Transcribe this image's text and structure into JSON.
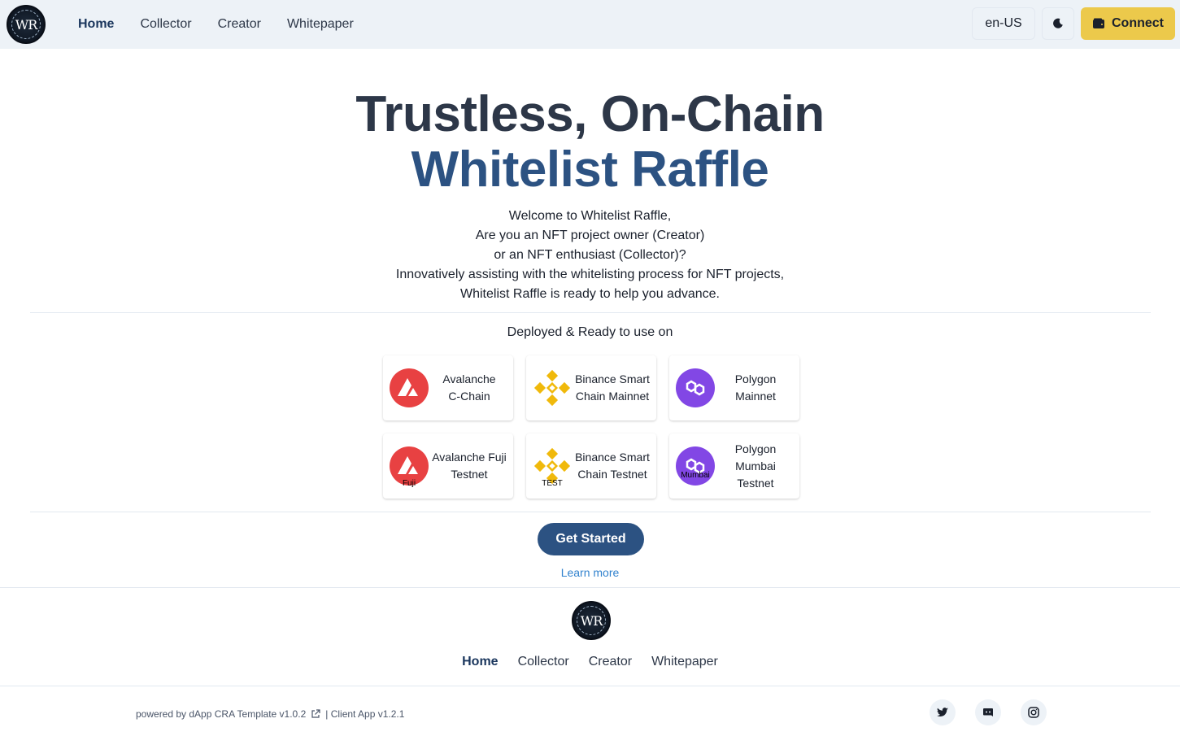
{
  "header": {
    "logo_text": "WR",
    "nav": [
      "Home",
      "Collector",
      "Creator",
      "Whitepaper"
    ],
    "language": "en-US",
    "connect_label": "Connect"
  },
  "hero": {
    "title_line1": "Trustless, On-Chain",
    "title_line2": "Whitelist Raffle",
    "intro": [
      "Welcome to Whitelist Raffle,",
      "Are you an NFT project owner (Creator)",
      "or an NFT enthusiast (Collector)?",
      "Innovatively assisting with the whitelisting process for NFT projects,",
      "Whitelist Raffle is ready to help you advance."
    ]
  },
  "deployed": {
    "heading": "Deployed & Ready to use on",
    "chains": [
      {
        "label_lines": [
          "Avalanche",
          "C-Chain"
        ],
        "icon": "avalanche-icon",
        "badge": ""
      },
      {
        "label_lines": [
          "Binance Smart",
          "Chain Mainnet"
        ],
        "icon": "binance-icon",
        "badge": ""
      },
      {
        "label_lines": [
          "Polygon",
          "Mainnet"
        ],
        "icon": "polygon-icon",
        "badge": ""
      },
      {
        "label_lines": [
          "Avalanche Fuji",
          "Testnet"
        ],
        "icon": "avalanche-icon",
        "badge": "Fuji"
      },
      {
        "label_lines": [
          "Binance Smart",
          "Chain Testnet"
        ],
        "icon": "binance-icon",
        "badge": "TEST"
      },
      {
        "label_lines": [
          "Polygon",
          "Mumbai",
          "Testnet"
        ],
        "icon": "polygon-icon",
        "badge": "Mumbai"
      }
    ]
  },
  "cta": {
    "get_started": "Get Started",
    "learn_more": "Learn more"
  },
  "footer": {
    "logo_text": "WR",
    "nav": [
      "Home",
      "Collector",
      "Creator",
      "Whitepaper"
    ],
    "powered_by": "powered by dApp CRA Template v1.0.2",
    "client_app": "| Client App v1.2.1",
    "social": [
      "twitter-icon",
      "discord-icon",
      "instagram-icon"
    ]
  },
  "colors": {
    "header_bg": "#edf2f7",
    "accent_blue": "#2c5282",
    "connect_yellow": "#ecc94b",
    "avalanche_red": "#e84142",
    "binance_yellow": "#f0b90b",
    "polygon_purple": "#8247e5"
  }
}
